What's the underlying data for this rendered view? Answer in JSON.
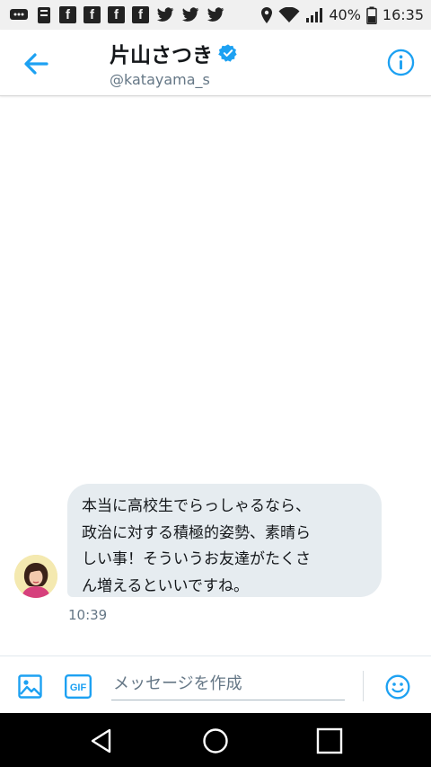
{
  "status_bar": {
    "battery": "40%",
    "time": "16:35"
  },
  "header": {
    "name": "片山さつき",
    "handle": "@katayama_s"
  },
  "messages": [
    {
      "lines": [
        "本当に高校生でらっしゃるなら、",
        "政治に対する積極的姿勢、素晴ら",
        "しい事！そういうお友達がたくさ",
        "ん増えるといいですね。"
      ],
      "time": "10:39"
    }
  ],
  "composer": {
    "placeholder": "メッセージを作成",
    "gif_label": "GIF"
  },
  "colors": {
    "accent": "#1da1f2",
    "bubble": "#e6ecf0",
    "text": "#14171a",
    "secondary_text": "#657786"
  }
}
